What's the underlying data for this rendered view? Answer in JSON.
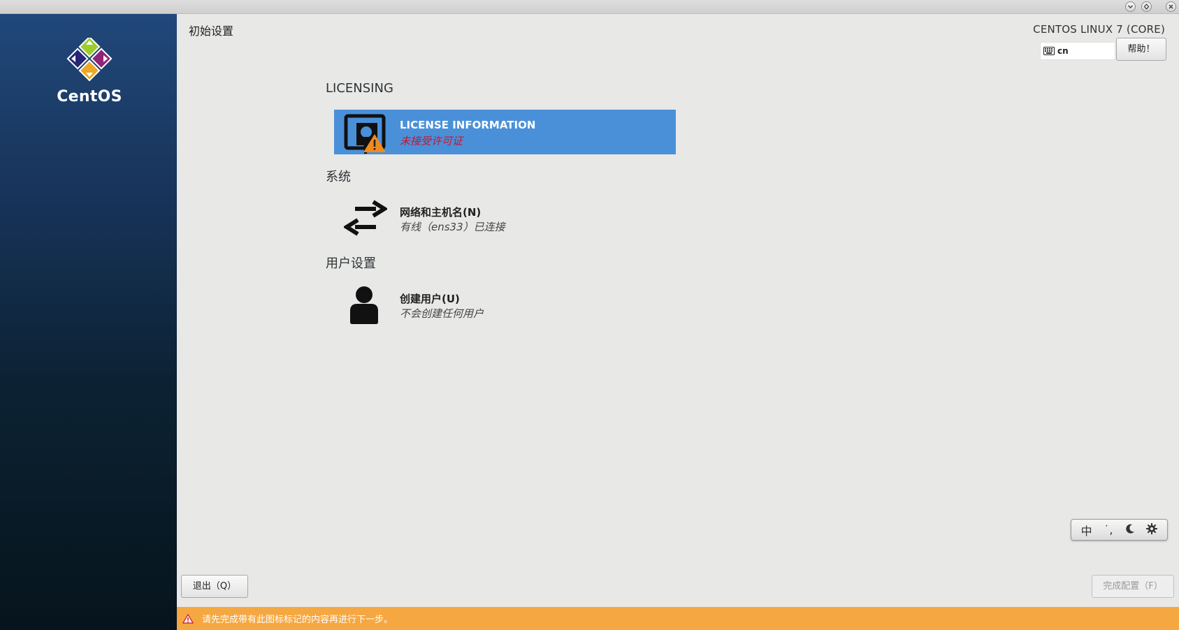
{
  "window": {
    "controls": [
      "chevron-down-icon",
      "restore-icon",
      "close-icon"
    ]
  },
  "sidebar": {
    "logo_text": "CentOS"
  },
  "header": {
    "title": "初始设置",
    "product": "CENTOS LINUX 7 (CORE)",
    "keyboard_layout": "cn",
    "help_label": "帮助！"
  },
  "sections": {
    "licensing": {
      "title": "LICENSING",
      "spoke": {
        "title": "LICENSE INFORMATION",
        "status": "未接受许可证",
        "icon": "license-warning-icon"
      }
    },
    "system": {
      "title": "系统",
      "spoke": {
        "title": "网络和主机名(N)",
        "status": "有线（ens33）已连接",
        "icon": "network-arrows-icon"
      }
    },
    "user": {
      "title": "用户设置",
      "spoke": {
        "title": "创建用户(U)",
        "status": "不会创建任何用户",
        "icon": "user-icon"
      }
    }
  },
  "ime": {
    "mode": "中",
    "punct": "˙,",
    "items": [
      "moon-icon",
      "gear-icon"
    ]
  },
  "footer": {
    "quit_label": "退出（Q）",
    "finish_label": "完成配置（F）",
    "warning_text": "请先完成带有此图标标记的内容再进行下一步。"
  },
  "colors": {
    "accent": "#4a90d9",
    "warning": "#f5a741",
    "warning_text_red": "#c7162b",
    "sidebar_top": "#21487a",
    "sidebar_bottom": "#06141c"
  }
}
